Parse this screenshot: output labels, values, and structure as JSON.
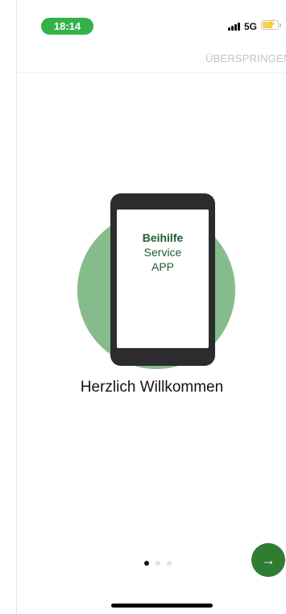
{
  "status_bar": {
    "time": "18:14",
    "network": "5G",
    "signal_icon": "signal-bars-icon",
    "battery_icon": "battery-charging-icon",
    "time_pill_color": "#34b24a"
  },
  "header": {
    "skip_label": "ÜBERSPRINGEN"
  },
  "illustration": {
    "brand_line1": "Beihilfe",
    "brand_line2": "Service",
    "brand_line3": "APP",
    "circle_color": "#86bc8c",
    "brand_color": "#1f5c2e"
  },
  "welcome_text": "Herzlich Willkommen",
  "pager": {
    "current_page": 1,
    "total_pages": 3
  },
  "next_button": {
    "icon": "arrow-right-icon",
    "glyph": "→",
    "color": "#2e7d32"
  }
}
